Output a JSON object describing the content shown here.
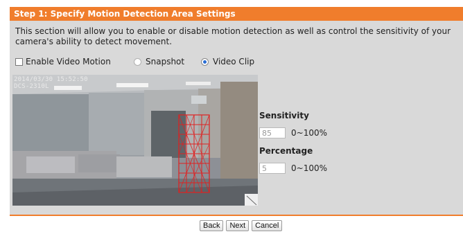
{
  "step": {
    "title": "Step 1: Specify Motion Detection Area Settings",
    "description": "This section will allow you to enable or disable motion detection as well as control the sensitivity of your camera's ability to detect movement."
  },
  "options": {
    "enable_label": "Enable Video Motion",
    "enable_checked": false,
    "snapshot_label": "Snapshot",
    "snapshot_selected": false,
    "videoclip_label": "Video Clip",
    "videoclip_selected": true
  },
  "camera": {
    "timestamp": "2014/03/30 15:52:50",
    "device": "DCS-2310L"
  },
  "sensitivity": {
    "label": "Sensitivity",
    "value": "85",
    "range": "0~100%"
  },
  "percentage": {
    "label": "Percentage",
    "value": "5",
    "range": "0~100%"
  },
  "buttons": {
    "back": "Back",
    "next": "Next",
    "cancel": "Cancel"
  },
  "colors": {
    "header": "#f07d2c",
    "panel": "#d9d9d9",
    "grid": "#e02020"
  }
}
